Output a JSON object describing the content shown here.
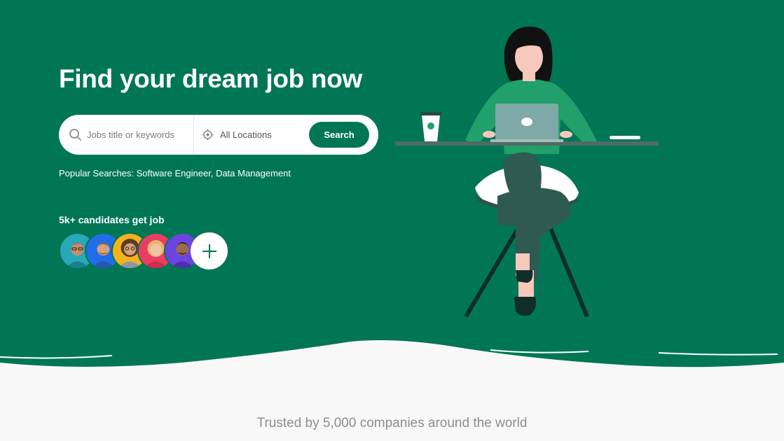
{
  "colors": {
    "brand": "#007655",
    "white": "#ffffff",
    "page_background": "#f8f8f8",
    "muted_text": "#8d8d8d"
  },
  "hero": {
    "title": "Find your dream job now",
    "search": {
      "keywords_placeholder": "Jobs title or keywords",
      "keywords_icon": "search-icon",
      "location_value": "All Locations",
      "location_icon": "location-target-icon",
      "button_label": "Search"
    },
    "popular": {
      "prefix": "Popular Searches:",
      "items": [
        "Software Engineer,",
        "Data Management"
      ]
    },
    "candidates": {
      "heading": "5k+ candidates get job",
      "avatars": [
        {
          "name": "avatar-1",
          "bg": "#29a8b8"
        },
        {
          "name": "avatar-2",
          "bg": "#1f6ee8"
        },
        {
          "name": "avatar-3",
          "bg": "#f6b21b"
        },
        {
          "name": "avatar-4",
          "bg": "#ea3d63"
        },
        {
          "name": "avatar-5",
          "bg": "#6b45e0"
        }
      ],
      "more_icon": "plus-icon"
    },
    "illustration_icon": "woman-at-laptop-illustration"
  },
  "trusted": {
    "text": "Trusted by 5,000 companies around the world"
  }
}
